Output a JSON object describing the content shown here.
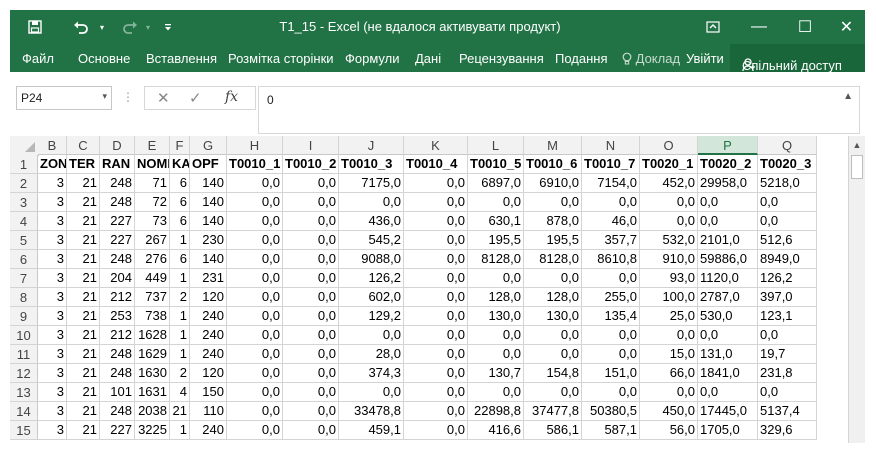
{
  "window": {
    "title": "T1_15  -  Excel (не вдалося активувати продукт)",
    "save_icon": "floppy-disk-icon",
    "undo_icon": "undo-icon",
    "redo_icon": "redo-icon",
    "customize_icon": "customize-qat-icon",
    "ribbon_display_icon": "ribbon-display-options-icon",
    "minimize": "—",
    "maximize": "☐",
    "close": "✕"
  },
  "ribbon": {
    "tabs": [
      "Файл",
      "Основне",
      "Вставлення",
      "Розмітка сторінки",
      "Формули",
      "Дані",
      "Рецензування",
      "Подання"
    ],
    "tell_me": "Доклад",
    "signin": "Увійти",
    "share": "Спільний доступ"
  },
  "formula_bar": {
    "name_box": "P24",
    "value": "0",
    "fx": "fx"
  },
  "columns": [
    "B",
    "C",
    "D",
    "E",
    "F",
    "G",
    "H",
    "I",
    "J",
    "K",
    "L",
    "M",
    "N",
    "O",
    "P",
    "Q"
  ],
  "selected_column": "P",
  "row_numbers": [
    "1",
    "2",
    "3",
    "4",
    "5",
    "6",
    "7",
    "8",
    "9",
    "10",
    "11",
    "12",
    "13",
    "14",
    "15"
  ],
  "header_row": [
    "ZONA",
    "TER",
    "RAN",
    "NOME",
    "KAT",
    "OPF",
    "T0010_1",
    "T0010_2",
    "T0010_3",
    "T0010_4",
    "T0010_5",
    "T0010_6",
    "T0010_7",
    "T0020_1",
    "T0020_2",
    "T0020_3"
  ],
  "rows": [
    [
      "3",
      "21",
      "248",
      "71",
      "6",
      "140",
      "0,0",
      "0,0",
      "7175,0",
      "0,0",
      "6897,0",
      "6910,0",
      "7154,0",
      "452,0",
      "29958,0",
      "5218,0"
    ],
    [
      "3",
      "21",
      "248",
      "72",
      "6",
      "140",
      "0,0",
      "0,0",
      "0,0",
      "0,0",
      "0,0",
      "0,0",
      "0,0",
      "0,0",
      "0,0",
      "0,0"
    ],
    [
      "3",
      "21",
      "227",
      "73",
      "6",
      "140",
      "0,0",
      "0,0",
      "436,0",
      "0,0",
      "630,1",
      "878,0",
      "46,0",
      "0,0",
      "0,0",
      "0,0"
    ],
    [
      "3",
      "21",
      "227",
      "267",
      "1",
      "230",
      "0,0",
      "0,0",
      "545,2",
      "0,0",
      "195,5",
      "195,5",
      "357,7",
      "532,0",
      "2101,0",
      "512,6"
    ],
    [
      "3",
      "21",
      "248",
      "276",
      "6",
      "140",
      "0,0",
      "0,0",
      "9088,0",
      "0,0",
      "8128,0",
      "8128,0",
      "8610,8",
      "910,0",
      "59886,0",
      "8949,0"
    ],
    [
      "3",
      "21",
      "204",
      "449",
      "1",
      "231",
      "0,0",
      "0,0",
      "126,2",
      "0,0",
      "0,0",
      "0,0",
      "0,0",
      "93,0",
      "1120,0",
      "126,2"
    ],
    [
      "3",
      "21",
      "212",
      "737",
      "2",
      "120",
      "0,0",
      "0,0",
      "602,0",
      "0,0",
      "128,0",
      "128,0",
      "255,0",
      "100,0",
      "2787,0",
      "397,0"
    ],
    [
      "3",
      "21",
      "253",
      "738",
      "1",
      "240",
      "0,0",
      "0,0",
      "129,2",
      "0,0",
      "130,0",
      "130,0",
      "135,4",
      "25,0",
      "530,0",
      "123,1"
    ],
    [
      "3",
      "21",
      "212",
      "1628",
      "1",
      "240",
      "0,0",
      "0,0",
      "0,0",
      "0,0",
      "0,0",
      "0,0",
      "0,0",
      "0,0",
      "0,0",
      "0,0"
    ],
    [
      "3",
      "21",
      "248",
      "1629",
      "1",
      "240",
      "0,0",
      "0,0",
      "28,0",
      "0,0",
      "0,0",
      "0,0",
      "0,0",
      "15,0",
      "131,0",
      "19,7"
    ],
    [
      "3",
      "21",
      "248",
      "1630",
      "2",
      "120",
      "0,0",
      "0,0",
      "374,3",
      "0,0",
      "130,7",
      "154,8",
      "151,0",
      "66,0",
      "1841,0",
      "231,8"
    ],
    [
      "3",
      "21",
      "101",
      "1631",
      "4",
      "150",
      "0,0",
      "0,0",
      "0,0",
      "0,0",
      "0,0",
      "0,0",
      "0,0",
      "0,0",
      "0,0",
      "0,0"
    ],
    [
      "3",
      "21",
      "248",
      "2038",
      "21",
      "110",
      "0,0",
      "0,0",
      "33478,8",
      "0,0",
      "22898,8",
      "37477,8",
      "50380,5",
      "450,0",
      "17445,0",
      "5137,4"
    ],
    [
      "3",
      "21",
      "227",
      "3225",
      "1",
      "240",
      "0,0",
      "0,0",
      "459,1",
      "0,0",
      "416,6",
      "586,1",
      "587,1",
      "56,0",
      "1705,0",
      "329,6"
    ]
  ],
  "colors": {
    "excel_green": "#217346",
    "selected_header_bg": "#d2e6d9"
  }
}
